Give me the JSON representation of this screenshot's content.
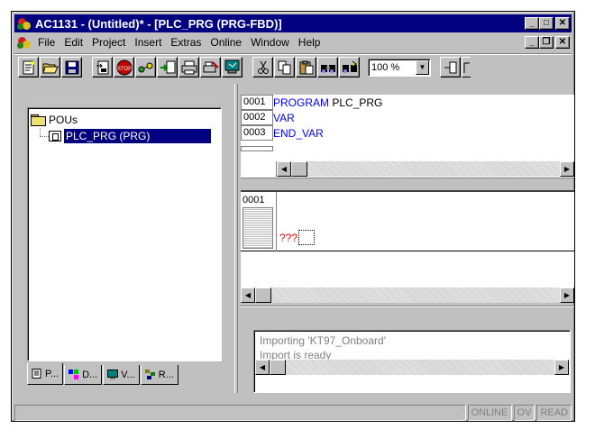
{
  "window": {
    "title": "AC1131 - (Untitled)* - [PLC_PRG (PRG-FBD)]"
  },
  "menubar": {
    "items": [
      "File",
      "Edit",
      "Project",
      "Insert",
      "Extras",
      "Online",
      "Window",
      "Help"
    ]
  },
  "toolbar": {
    "zoom_value": "100 %"
  },
  "tree": {
    "root_label": "POUs",
    "child_label": "PLC_PRG (PRG)"
  },
  "tabs": [
    {
      "label": "P..."
    },
    {
      "label": "D..."
    },
    {
      "label": "V..."
    },
    {
      "label": "R..."
    }
  ],
  "declaration": {
    "lines": [
      {
        "num": "0001",
        "keyword": "PROGRAM",
        "rest": " PLC_PRG"
      },
      {
        "num": "0002",
        "keyword": "VAR",
        "rest": ""
      },
      {
        "num": "0003",
        "keyword": "END_VAR",
        "rest": ""
      }
    ]
  },
  "fbd": {
    "network_number": "0001",
    "placeholder": "???"
  },
  "messages": [
    "Importing 'KT97_Onboard'",
    "Import is ready"
  ],
  "status": {
    "online": "ONLINE",
    "ov": "OV",
    "read": "READ"
  }
}
